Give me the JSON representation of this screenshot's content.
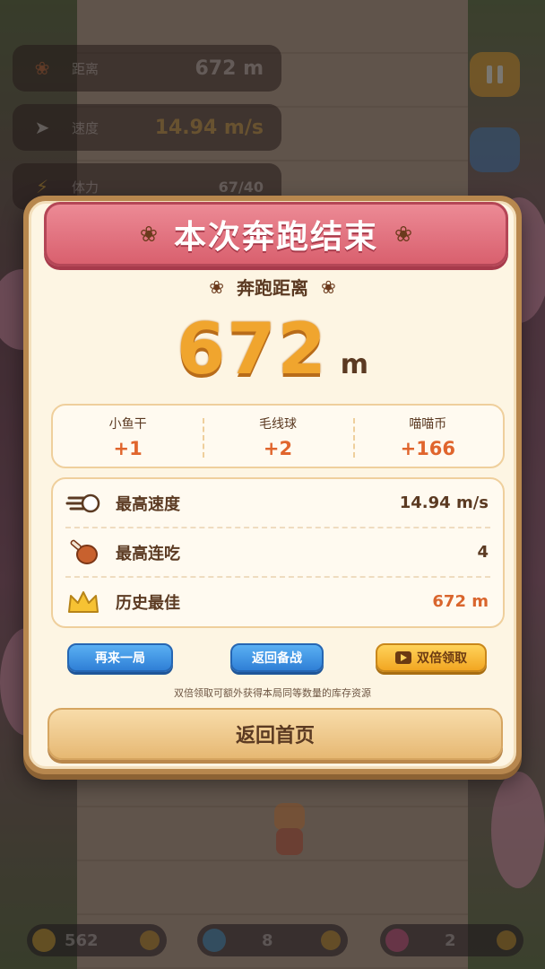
{
  "hud": {
    "distance_label": "距离",
    "distance_value": "672 m",
    "speed_label": "速度",
    "speed_value": "14.94 m/s",
    "stamina_label": "体力",
    "stamina_value": "67/40"
  },
  "result": {
    "title": "本次奔跑结束",
    "distance_label": "奔跑距离",
    "distance_value": "672",
    "distance_unit": "m",
    "rewards": [
      {
        "name": "小鱼干",
        "value": "+1"
      },
      {
        "name": "毛线球",
        "value": "+2"
      },
      {
        "name": "喵喵币",
        "value": "+166"
      }
    ],
    "stats": [
      {
        "label": "最高速度",
        "value": "14.94 m/s",
        "icon": "wind-icon"
      },
      {
        "label": "最高连吃",
        "value": "4",
        "icon": "drumstick-icon"
      },
      {
        "label": "历史最佳",
        "value": "672 m",
        "icon": "crown-icon"
      }
    ],
    "buttons": {
      "again": "再来一局",
      "back_prep": "返回备战",
      "double_claim": "双倍领取",
      "home": "返回首页"
    },
    "note": "双倍领取可额外获得本局同等数量的库存资源"
  },
  "bottom_bar": {
    "coins": "562",
    "fish": "8",
    "yarn": "2"
  },
  "colors": {
    "banner": "#d9606e",
    "accent_orange": "#f0a52e",
    "reward_value": "#e0652d",
    "button_blue": "#2f7fd6",
    "button_gold": "#f2a622"
  }
}
